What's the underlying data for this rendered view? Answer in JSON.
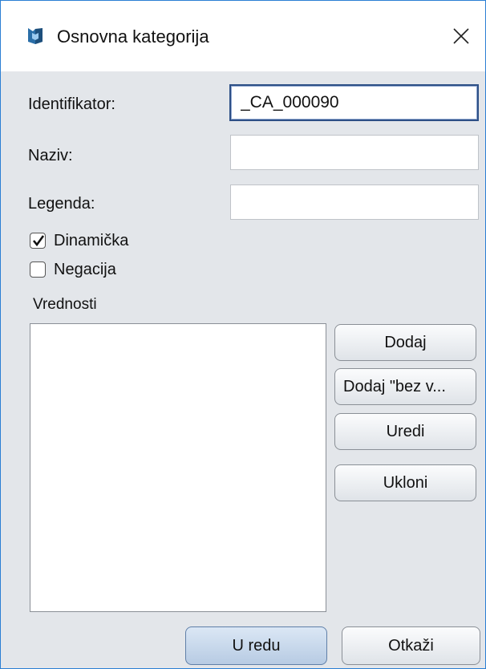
{
  "window": {
    "title": "Osnovna kategorija",
    "icon": "app-icon",
    "close_icon": "close-icon"
  },
  "form": {
    "identifier_label": "Identifikator:",
    "identifier_value": "_CA_000090",
    "name_label": "Naziv:",
    "name_value": "",
    "legend_label": "Legenda:",
    "legend_value": "",
    "dynamic_label": "Dinamička",
    "dynamic_checked": true,
    "negation_label": "Negacija",
    "negation_checked": false,
    "values_label": "Vrednosti"
  },
  "side_buttons": {
    "add": "Dodaj",
    "add_without": "Dodaj \"bez v...",
    "edit": "Uredi",
    "remove": "Ukloni"
  },
  "footer": {
    "ok": "U redu",
    "cancel": "Otkaži"
  },
  "colors": {
    "accent": "#2b7fd4",
    "background": "#e3e6ea"
  }
}
